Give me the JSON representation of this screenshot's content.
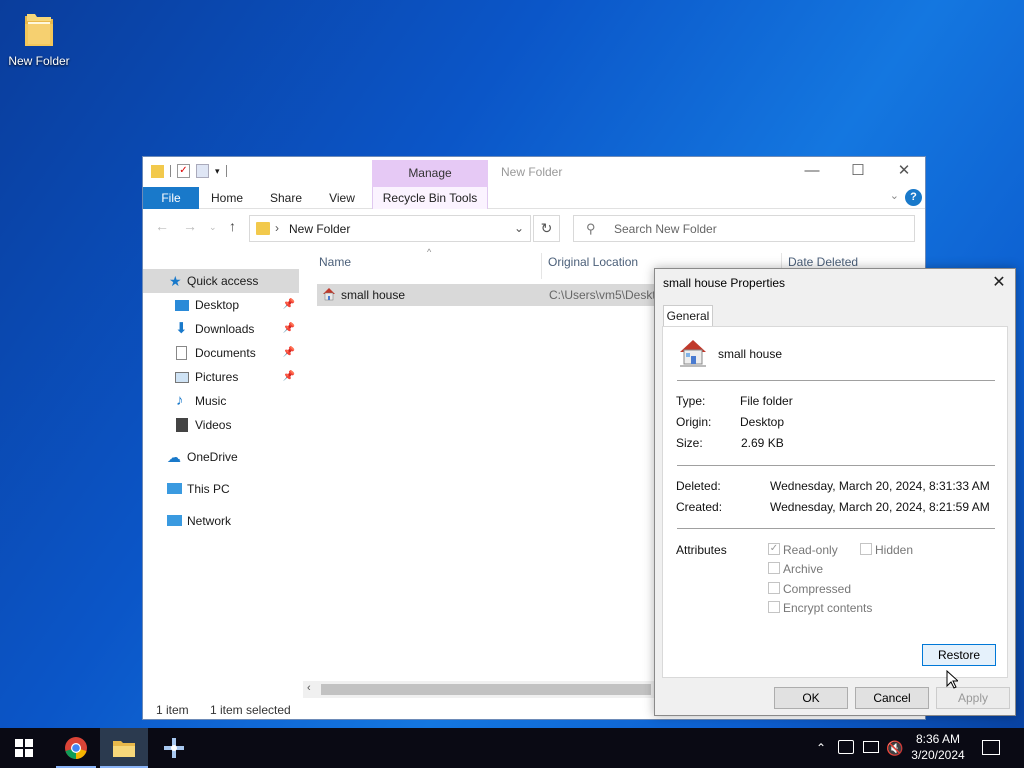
{
  "desktop": {
    "icon_label": "New Folder"
  },
  "explorer": {
    "title": "New Folder",
    "manage_tab": "Manage",
    "ribbon_tabs": [
      "File",
      "Home",
      "Share",
      "View",
      "Recycle Bin Tools"
    ],
    "address": "New Folder",
    "search_placeholder": "Search New Folder",
    "columns": [
      "Name",
      "Original Location",
      "Date Deleted"
    ],
    "file": {
      "name": "small house",
      "location": "C:\\Users\\vm5\\Deskt"
    },
    "nav": {
      "quick_access": "Quick access",
      "items": [
        "Desktop",
        "Downloads",
        "Documents",
        "Pictures",
        "Music",
        "Videos"
      ],
      "onedrive": "OneDrive",
      "thispc": "This PC",
      "network": "Network"
    },
    "status": {
      "count": "1 item",
      "selected": "1 item selected"
    }
  },
  "props": {
    "title": "small house Properties",
    "tab": "General",
    "name": "small house",
    "type_label": "Type:",
    "type_value": "File folder",
    "origin_label": "Origin:",
    "origin_value": "Desktop",
    "size_label": "Size:",
    "size_value": "2.69 KB",
    "deleted_label": "Deleted:",
    "deleted_value": "Wednesday, March 20, 2024, 8:31:33 AM",
    "created_label": "Created:",
    "created_value": "Wednesday, March 20, 2024, 8:21:59 AM",
    "attributes_label": "Attributes",
    "attr": {
      "readonly": "Read-only",
      "hidden": "Hidden",
      "archive": "Archive",
      "compressed": "Compressed",
      "encrypt": "Encrypt contents"
    },
    "buttons": {
      "restore": "Restore",
      "ok": "OK",
      "cancel": "Cancel",
      "apply": "Apply"
    }
  },
  "taskbar": {
    "time": "8:36 AM",
    "date": "3/20/2024"
  }
}
